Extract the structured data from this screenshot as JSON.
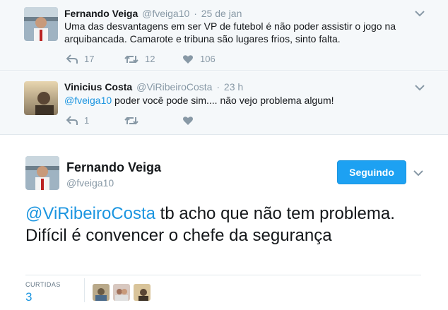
{
  "tweets": [
    {
      "name": "Fernando Veiga",
      "handle": "@fveiga10",
      "separator": "·",
      "time": "25 de jan",
      "text": "Uma das desvantagens em ser VP de futebol é não poder assistir o jogo na arquibancada. Camarote e tribuna são lugares frios, sinto falta.",
      "replies": "17",
      "retweets": "12",
      "likes": "106"
    },
    {
      "name": "Vinicius Costa",
      "handle": "@ViRibeiroCosta",
      "separator": "·",
      "time": "23 h",
      "mention": "@fveiga10",
      "text": " poder você pode sim.... não vejo problema algum!",
      "replies": "1",
      "retweets": "",
      "likes": ""
    }
  ],
  "main_tweet": {
    "name": "Fernando Veiga",
    "handle": "@fveiga10",
    "follow_label": "Seguindo",
    "mention": "@ViRibeiroCosta",
    "text": " tb acho que não tem problema. Difícil é convencer o chefe da segurança",
    "stats_label": "CURTIDAS",
    "stats_count": "3"
  },
  "colors": {
    "accent": "#1da1f2",
    "link": "#1b95e0",
    "muted": "#8899a6",
    "context_bg": "#f5f8fa"
  },
  "icons": [
    "reply-icon",
    "retweet-icon",
    "heart-icon",
    "chevron-down-icon"
  ]
}
